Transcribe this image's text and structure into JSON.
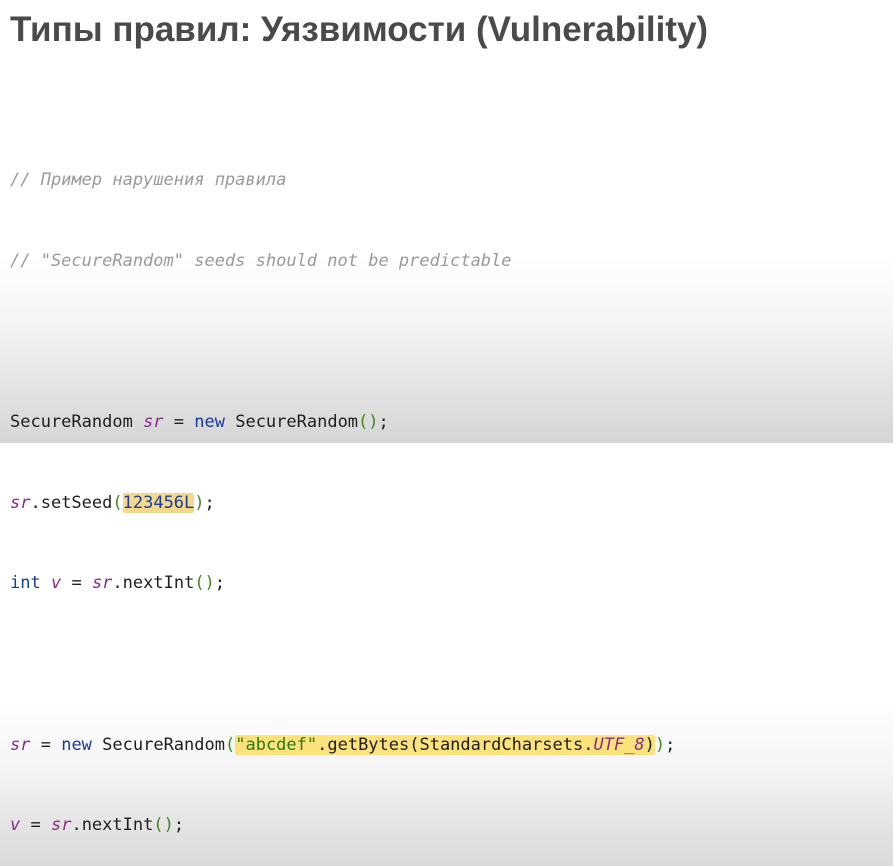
{
  "slide": {
    "title": "Типы правил: Уязвимости (Vulnerability)"
  },
  "code": {
    "comment1": "// Пример нарушения правила",
    "comment2": "// \"SecureRandom\" seeds should not be predictable",
    "l3_type": "SecureRandom ",
    "l3_var": "sr",
    "l3_eq": " = ",
    "l3_new": "new",
    "l3_ctor": " SecureRandom",
    "l3_parens": "()",
    "l3_semi": ";",
    "l4_var": "sr",
    "l4_call": ".setSeed",
    "l4_open": "(",
    "l4_seed": "123456L",
    "l4_close": ")",
    "l4_semi": ";",
    "l5_int": "int",
    "l5_sp": " ",
    "l5_v": "v",
    "l5_eq": " = ",
    "l5_sr": "sr",
    "l5_call": ".nextInt",
    "l5_parens": "()",
    "l5_semi": ";",
    "l6_var": "sr",
    "l6_eq": " = ",
    "l6_new": "new",
    "l6_ctor": " SecureRandom",
    "l6_open": "(",
    "l6_str": "\"abcdef\"",
    "l6_getbytes": ".getBytes(StandardCharsets.",
    "l6_const": "UTF_8",
    "l6_close1": ")",
    "l6_close2": ")",
    "l6_semi": ";",
    "l7_v": "v",
    "l7_eq": " = ",
    "l7_sr": "sr",
    "l7_call": ".nextInt",
    "l7_parens": "()",
    "l7_semi": ";"
  }
}
